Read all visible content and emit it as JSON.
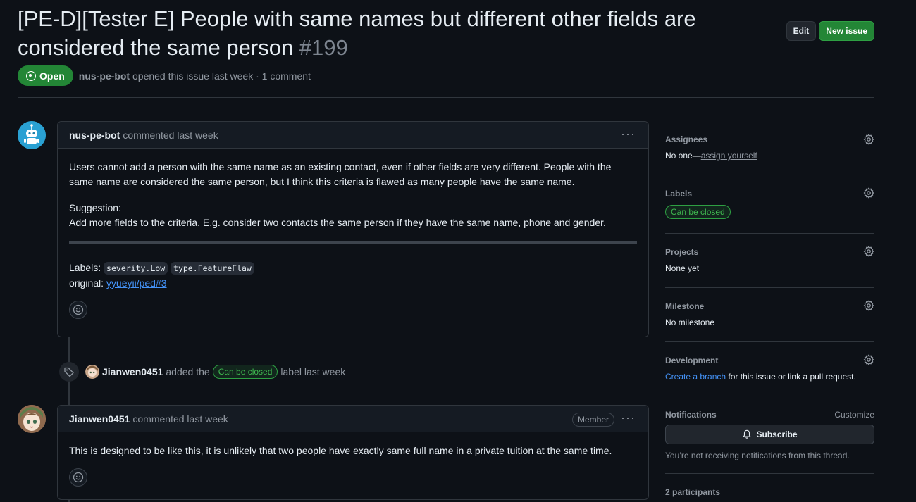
{
  "issue": {
    "title": "[PE-D][Tester E] People with same names but different other fields are considered the same person",
    "number": "#199",
    "state": "Open",
    "author": "nus-pe-bot",
    "meta_text": "opened this issue last week · 1 comment"
  },
  "header_buttons": {
    "edit": "Edit",
    "new_issue": "New issue"
  },
  "comment1": {
    "author": "nus-pe-bot",
    "time": "commented last week",
    "p1": "Users cannot add a person with the same name as an existing contact, even if other fields are very different. People with the same name are considered the same person, but I think this criteria is flawed as many people have the same name.",
    "p2a": "Suggestion:",
    "p2b": "Add more fields to the criteria. E.g. consider two contacts the same person if they have the same name, phone and gender.",
    "labels_prefix": "Labels:",
    "label1": "severity.Low",
    "label2": "type.FeatureFlaw",
    "original_prefix": "original:",
    "original_link": "yyueyii/ped#3"
  },
  "event": {
    "actor": "Jianwen0451",
    "action": "added the",
    "label": "Can be closed",
    "suffix": "label last week"
  },
  "comment2": {
    "author": "Jianwen0451",
    "time": "commented last week",
    "badge": "Member",
    "body": "This is designed to be like this, it is unlikely that two people have exactly same full name in a private tuition at the same time."
  },
  "sidebar": {
    "assignees": {
      "title": "Assignees",
      "prefix": "No one—",
      "link": "assign yourself"
    },
    "labels": {
      "title": "Labels",
      "label": "Can be closed"
    },
    "projects": {
      "title": "Projects",
      "value": "None yet"
    },
    "milestone": {
      "title": "Milestone",
      "value": "No milestone"
    },
    "development": {
      "title": "Development",
      "link": "Create a branch",
      "suffix": "for this issue or link a pull request."
    },
    "notifications": {
      "title": "Notifications",
      "customize": "Customize",
      "subscribe": "Subscribe",
      "note": "You’re not receiving notifications from this thread."
    },
    "participants": {
      "title": "2 participants"
    }
  },
  "colors": {
    "open_green": "#238636",
    "link_blue": "#4493f8",
    "label_green": "#3fb950"
  }
}
